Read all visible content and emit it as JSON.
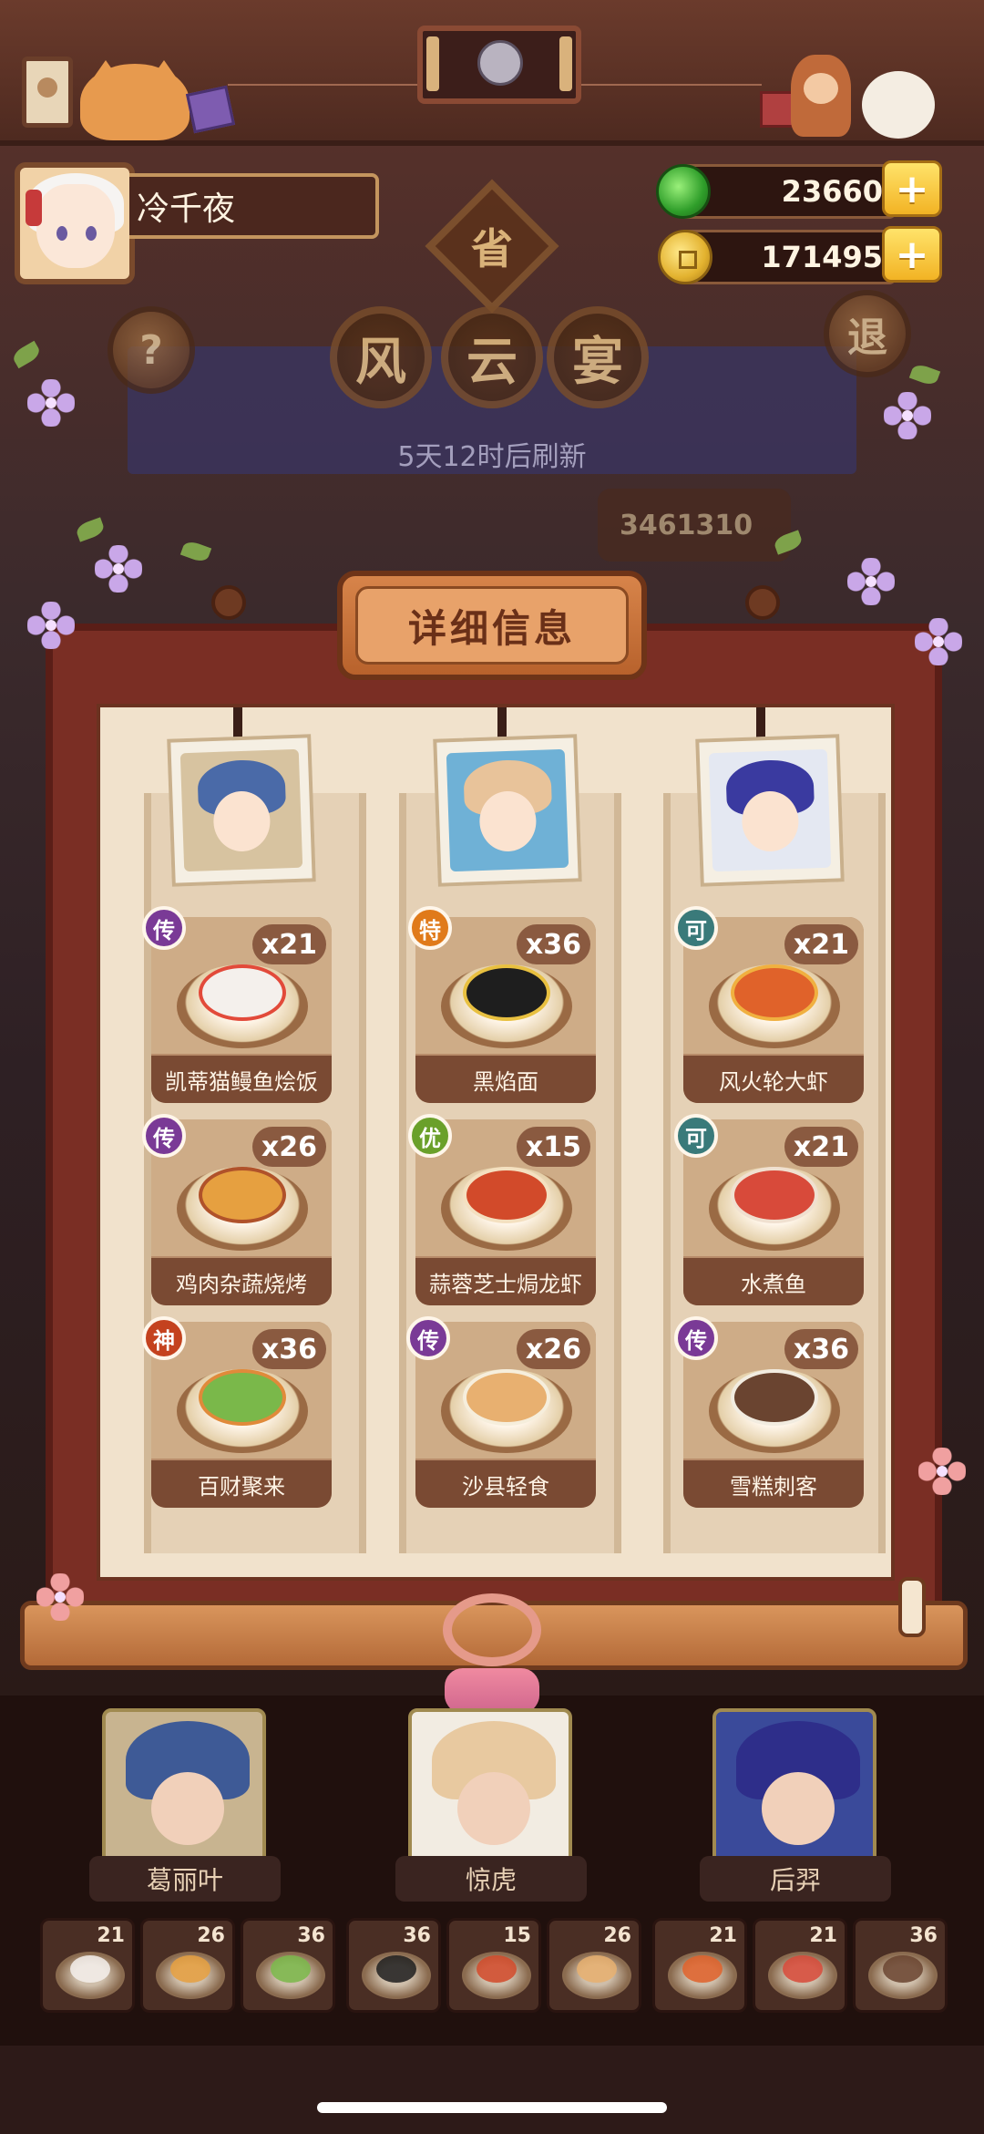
{
  "player": {
    "name": "冷千夜"
  },
  "currencies": [
    {
      "type": "jade",
      "amount": "23660"
    },
    {
      "type": "coin",
      "amount": "171495"
    }
  ],
  "event": {
    "province_char": "省",
    "title_chars": [
      "风",
      "云",
      "宴"
    ],
    "help_label": "?",
    "exit_label": "退",
    "refresh_text": "5天12时后刷新",
    "score": "3461310"
  },
  "dialog": {
    "title": "详细信息"
  },
  "columns": [
    {
      "portrait_colors": {
        "bg": "#d7c3a0",
        "hair": "#4a6aa8"
      },
      "dishes": [
        {
          "grade": "传",
          "grade_color": "#7a3a96",
          "name": "凯蒂猫鳗鱼烩饭",
          "count": "x21",
          "food_color": "#f4f0ec"
        },
        {
          "grade": "传",
          "grade_color": "#7a3a96",
          "name": "鸡肉杂蔬烧烤",
          "count": "x26",
          "food_color": "#e6a040"
        },
        {
          "grade": "神",
          "grade_color": "#c4421e",
          "name": "百财聚来",
          "count": "x36",
          "food_color": "#7ab84a"
        }
      ]
    },
    {
      "portrait_colors": {
        "bg": "#6fb1d6",
        "hair": "#e8c39a"
      },
      "dishes": [
        {
          "grade": "特",
          "grade_color": "#e07a1a",
          "name": "黑焰面",
          "count": "x36",
          "food_color": "#1e1e1e"
        },
        {
          "grade": "优",
          "grade_color": "#6aa02a",
          "name": "蒜蓉芝士焗龙虾",
          "count": "x15",
          "food_color": "#d24a2a"
        },
        {
          "grade": "传",
          "grade_color": "#7a3a96",
          "name": "沙县轻食",
          "count": "x26",
          "food_color": "#e8b070"
        }
      ]
    },
    {
      "portrait_colors": {
        "bg": "#e4e8f2",
        "hair": "#3a3aa0"
      },
      "dishes": [
        {
          "grade": "可",
          "grade_color": "#3a7a7a",
          "name": "风火轮大虾",
          "count": "x21",
          "food_color": "#e0622a"
        },
        {
          "grade": "可",
          "grade_color": "#3a7a7a",
          "name": "水煮鱼",
          "count": "x21",
          "food_color": "#d84a3a"
        },
        {
          "grade": "传",
          "grade_color": "#7a3a96",
          "name": "雪糕刺客",
          "count": "x36",
          "food_color": "#6a4430"
        }
      ]
    }
  ],
  "chefs": [
    {
      "name": "葛丽叶",
      "hair_color": "#3e5a96",
      "bg": "#c8b490"
    },
    {
      "name": "惊虎",
      "hair_color": "#e8c9a0",
      "bg": "#f2ece2"
    },
    {
      "name": "后羿",
      "hair_color": "#2e2e8a",
      "bg": "#3a4a9a"
    }
  ],
  "dish_strip": [
    {
      "count": "21",
      "food_color": "#f4f0ec"
    },
    {
      "count": "26",
      "food_color": "#e6a040"
    },
    {
      "count": "36",
      "food_color": "#7ab84a"
    },
    {
      "count": "36",
      "food_color": "#1e1e1e"
    },
    {
      "count": "15",
      "food_color": "#d24a2a"
    },
    {
      "count": "26",
      "food_color": "#e8b070"
    },
    {
      "count": "21",
      "food_color": "#e0622a"
    },
    {
      "count": "21",
      "food_color": "#d84a3a"
    },
    {
      "count": "36",
      "food_color": "#6a4430"
    }
  ],
  "colors": {
    "scroll_red": "#7a2e24",
    "paper": "#f1e2cc",
    "gold_button": "#f2b324"
  }
}
